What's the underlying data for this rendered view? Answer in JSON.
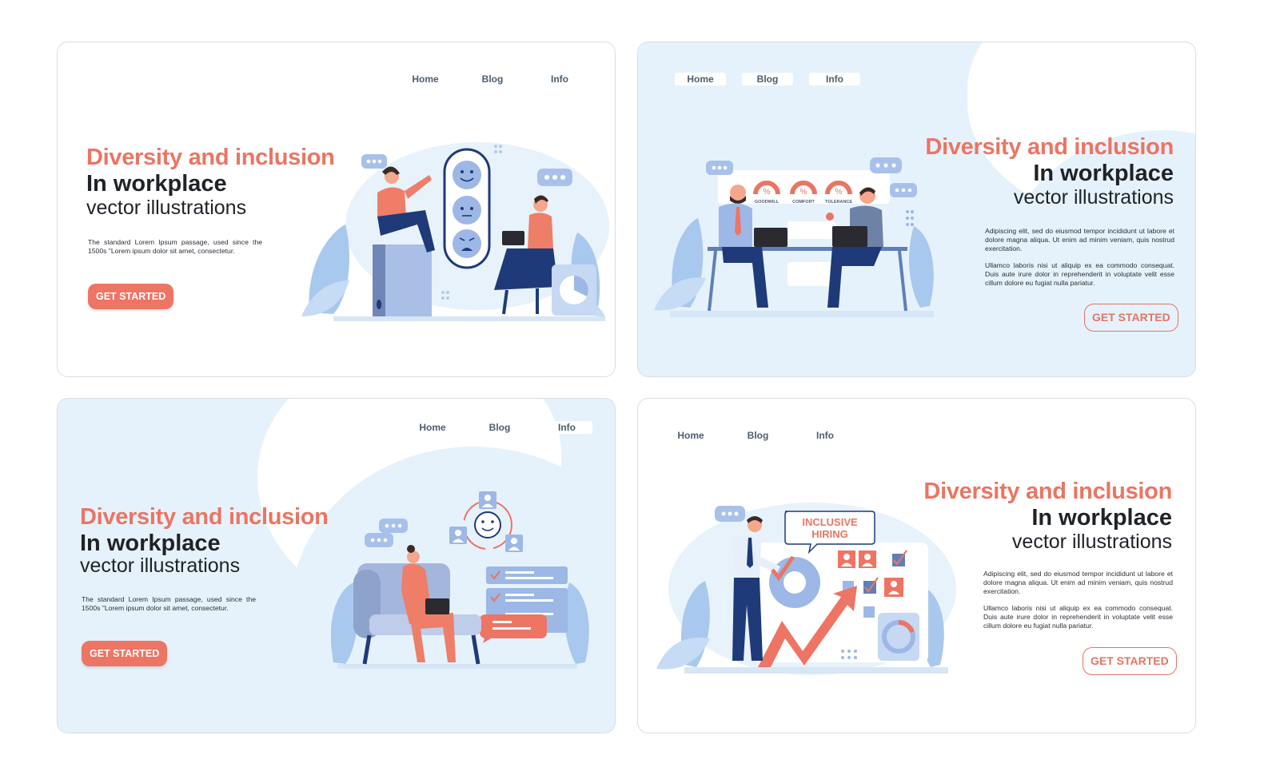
{
  "colors": {
    "accent": "#ee7464",
    "heading_dark": "#1f2228",
    "nav_text": "#4b5d70",
    "light_blue_bg": "#e6f2fb",
    "illustration_blue": "#8fb3e6",
    "navy": "#1e3a78"
  },
  "panels": [
    {
      "nav": [
        "Home",
        "Blog",
        "Info"
      ],
      "title_line1": "Diversity and inclusion",
      "title_line2": "In workplace",
      "title_line3": "vector illustrations",
      "description": [
        "The standard Lorem Ipsum passage, used since the 1500s \"Lorem ipsum dolor sit amet, consectetur."
      ],
      "cta": "GET STARTED",
      "illustration": {
        "theme": "feedback-emotions",
        "icons": [
          "smile-face-icon",
          "neutral-face-icon",
          "angry-face-icon",
          "chat-bubble-icon",
          "laptop-icon",
          "folder-icon"
        ]
      }
    },
    {
      "nav": [
        "Home",
        "Blog",
        "Info"
      ],
      "title_line1": "Diversity and inclusion",
      "title_line2": "In workplace",
      "title_line3": "vector illustrations",
      "description": [
        "Adipiscing elit, sed do eiusmod tempor incididunt ut labore et dolore magna aliqua. Ut enim ad minim veniam, quis nostrud exercitation.",
        "Ullamco laboris nisi ut aliquip ex ea commodo consequat. Duis aute irure dolor in reprehenderit in voluptate velit esse cillum dolore eu fugiat nulla pariatur."
      ],
      "cta": "GET STARTED",
      "illustration": {
        "theme": "office-meeting-metrics",
        "gauges": [
          {
            "label": "GOODWILL",
            "symbol": "%"
          },
          {
            "label": "COMFORT",
            "symbol": "%"
          },
          {
            "label": "TOLERANCE",
            "symbol": "%"
          }
        ]
      }
    },
    {
      "nav": [
        "Home",
        "Blog",
        "Info"
      ],
      "title_line1": "Diversity and inclusion",
      "title_line2": "In workplace",
      "title_line3": "vector illustrations",
      "description": [
        "The standard Lorem Ipsum passage, used since the 1500s \"Lorem ipsum dolor sit amet, consectetur."
      ],
      "cta": "GET STARTED",
      "illustration": {
        "theme": "team-cycle-checklist",
        "icons": [
          "user-icon",
          "smile-face-icon",
          "cycle-arrows-icon",
          "checklist-icon",
          "chat-bubble-icon",
          "laptop-icon"
        ]
      }
    },
    {
      "nav": [
        "Home",
        "Blog",
        "Info"
      ],
      "title_line1": "Diversity and inclusion",
      "title_line2": "In workplace",
      "title_line3": "vector illustrations",
      "description": [
        "Adipiscing elit, sed do eiusmod tempor incididunt ut labore et dolore magna aliqua. Ut enim ad minim veniam, quis nostrud exercitation.",
        "Ullamco laboris nisi ut aliquip ex ea commodo consequat. Duis aute irure dolor in reprehenderit in voluptate velit esse cillum dolore eu fugiat nulla pariatur."
      ],
      "cta": "GET STARTED",
      "illustration": {
        "theme": "inclusive-hiring",
        "speech_bubble": [
          "INCLUSIVE",
          "HIRING"
        ],
        "icons": [
          "donut-chart-icon",
          "growth-arrow-icon",
          "user-icon",
          "checkbox-icon"
        ]
      }
    }
  ]
}
